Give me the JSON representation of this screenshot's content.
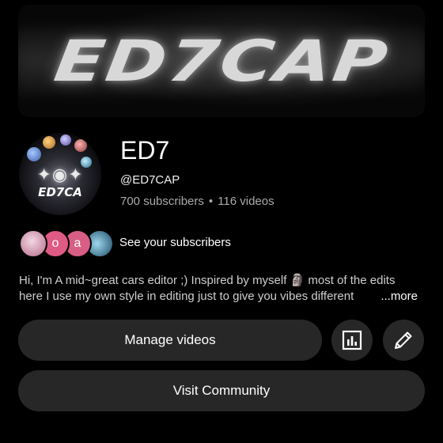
{
  "banner": {
    "text": "ED7CAP"
  },
  "avatar": {
    "text": "ED7CA"
  },
  "channel": {
    "name": "ED7",
    "handle": "@ED7CAP",
    "subscribers": "700 subscribers",
    "separator": "•",
    "videos": "116 videos"
  },
  "subscribers_row": {
    "avatars": [
      "",
      "o",
      "a",
      ""
    ],
    "link_label": "See your subscribers"
  },
  "description": {
    "line1": "Hi, I'm A mid~great cars editor ;) Inspired by myself 🗿 most of the edits",
    "line2": "here I use my own style in editing just to give you vibes different",
    "more_label": "...more"
  },
  "buttons": {
    "manage_videos": "Manage videos",
    "visit_community": "Visit Community"
  },
  "icons": {
    "analytics": "analytics-icon",
    "edit": "pencil-icon"
  }
}
